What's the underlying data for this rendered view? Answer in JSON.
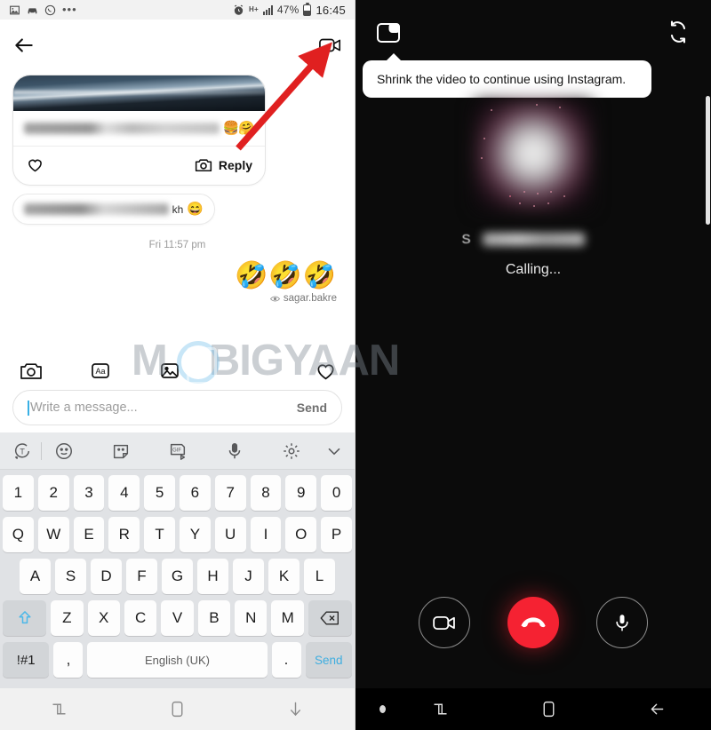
{
  "left_screen": {
    "status_bar": {
      "icons": [
        "image-icon",
        "car-icon",
        "whatsapp-icon",
        "more-dots-icon"
      ],
      "alarm_icon": "alarm-icon",
      "network_type": "H+",
      "signal_icon": "signal-bars-icon",
      "battery_percent": "47%",
      "battery_icon": "battery-icon",
      "time": "16:45"
    },
    "app_bar": {
      "back_icon": "back-arrow-icon",
      "title": "",
      "video_call_icon": "video-camera-icon"
    },
    "thread": {
      "post_card": {
        "image": "seascape-photo",
        "text": "",
        "emojis": "🍔🤗",
        "like_icon": "heart-icon",
        "reply_camera_icon": "camera-icon",
        "reply_label": "Reply"
      },
      "incoming_message": {
        "text": "",
        "visible_tail": "kh",
        "emoji": "😄"
      },
      "timestamp": "Fri 11:57 pm",
      "outgoing_reaction": {
        "emojis": "🤣🤣🤣",
        "seen_icon": "eye-icon",
        "seen_by": "sagar.bakre"
      }
    },
    "composer": {
      "camera_icon": "camera-icon",
      "text_icon": "aa-text-icon",
      "gallery_icon": "image-icon",
      "heart_icon": "heart-icon",
      "placeholder": "Write a message...",
      "send_label": "Send"
    },
    "keyboard": {
      "toolbar_icons": [
        "text-recognition-icon",
        "emoji-icon",
        "sticker-icon",
        "gif-icon",
        "microphone-icon",
        "settings-gear-icon",
        "chevron-down-icon"
      ],
      "row_numbers": [
        "1",
        "2",
        "3",
        "4",
        "5",
        "6",
        "7",
        "8",
        "9",
        "0"
      ],
      "row_top": [
        "Q",
        "W",
        "E",
        "R",
        "T",
        "Y",
        "U",
        "I",
        "O",
        "P"
      ],
      "row_home": [
        "A",
        "S",
        "D",
        "F",
        "G",
        "H",
        "J",
        "K",
        "L"
      ],
      "row_bottom": [
        "Z",
        "X",
        "C",
        "V",
        "B",
        "N",
        "M"
      ],
      "shift_icon": "shift-up-arrow-icon",
      "delete_icon": "backspace-icon",
      "symbols_key": "!#1",
      "comma_key": ",",
      "space_key": "English (UK)",
      "period_key": ".",
      "send_key": "Send"
    },
    "nav_bar": {
      "recents_icon": "recents-icon",
      "home_icon": "home-icon",
      "hide_keyboard_icon": "down-arrow-icon"
    }
  },
  "right_screen": {
    "top_bar": {
      "minimize_icon": "shrink-pip-icon",
      "flip_camera_icon": "rotate-camera-icon"
    },
    "tooltip": "Shrink the video to continue using Instagram.",
    "call": {
      "avatar": "blurred-profile-photo",
      "contact_name": "",
      "status": "Calling..."
    },
    "controls": {
      "video_toggle_icon": "video-camera-icon",
      "end_call_icon": "end-call-icon",
      "mute_icon": "microphone-icon"
    },
    "nav_bar": {
      "dot_icon": "dot-icon",
      "recents_icon": "recents-icon",
      "home_icon": "home-icon",
      "back_icon": "back-arrow-icon"
    }
  },
  "annotations": {
    "arrow": "red-arrow-pointing-to-video-call-button",
    "arrow_color": "#E02020"
  },
  "watermark": {
    "text_left": "M",
    "text_right": "BIGYAAN",
    "full": "MOBIGYAAN"
  }
}
